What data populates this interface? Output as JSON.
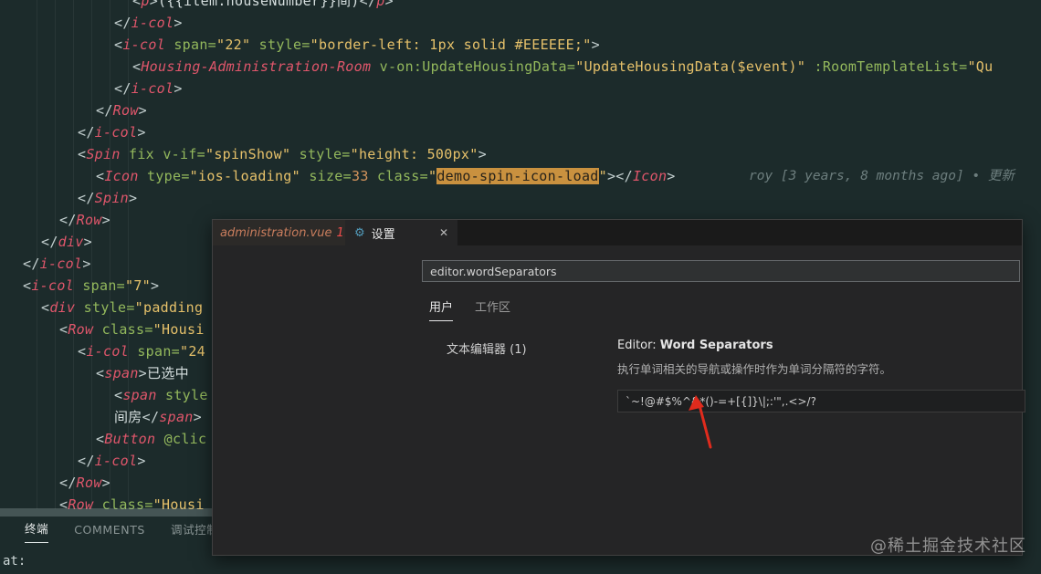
{
  "editor": {
    "lines": [
      {
        "indent": 6,
        "s": [
          [
            "br",
            "<"
          ],
          [
            "tag",
            "p"
          ],
          [
            "br",
            ">"
          ],
          [
            "txt",
            "({{item.houseNumber}}间)"
          ],
          [
            "br",
            "</"
          ],
          [
            "tag",
            "p"
          ],
          [
            "br",
            ">"
          ]
        ]
      },
      {
        "indent": 5,
        "s": [
          [
            "br",
            "</"
          ],
          [
            "tag",
            "i-col"
          ],
          [
            "br",
            ">"
          ]
        ]
      },
      {
        "indent": 5,
        "s": [
          [
            "br",
            "<"
          ],
          [
            "tag",
            "i-col"
          ],
          [
            "attr",
            " span="
          ],
          [
            "str",
            "\"22\""
          ],
          [
            "attr",
            " style="
          ],
          [
            "str",
            "\"border-left: 1px solid #EEEEEE;\""
          ],
          [
            "br",
            ">"
          ]
        ]
      },
      {
        "indent": 6,
        "s": [
          [
            "br",
            "<"
          ],
          [
            "tag",
            "Housing-Administration-Room"
          ],
          [
            "attr",
            " v-on:UpdateHousingData="
          ],
          [
            "str",
            "\"UpdateHousingData($event)\""
          ],
          [
            "attr",
            " :RoomTemplateList="
          ],
          [
            "str",
            "\"Qu"
          ]
        ]
      },
      {
        "indent": 5,
        "s": [
          [
            "br",
            "</"
          ],
          [
            "tag",
            "i-col"
          ],
          [
            "br",
            ">"
          ]
        ]
      },
      {
        "indent": 4,
        "s": [
          [
            "br",
            "</"
          ],
          [
            "tag",
            "Row"
          ],
          [
            "br",
            ">"
          ]
        ]
      },
      {
        "indent": 3,
        "s": [
          [
            "br",
            "</"
          ],
          [
            "tag",
            "i-col"
          ],
          [
            "br",
            ">"
          ]
        ]
      },
      {
        "indent": 3,
        "s": [
          [
            "br",
            "<"
          ],
          [
            "tag",
            "Spin"
          ],
          [
            "attr",
            " fix v-if="
          ],
          [
            "str",
            "\"spinShow\""
          ],
          [
            "attr",
            " style="
          ],
          [
            "str",
            "\"height: 500px\""
          ],
          [
            "br",
            ">"
          ]
        ]
      },
      {
        "indent": 4,
        "s": [
          [
            "br",
            "<"
          ],
          [
            "tag",
            "Icon"
          ],
          [
            "attr",
            " type="
          ],
          [
            "str",
            "\"ios-loading\""
          ],
          [
            "attr",
            " size="
          ],
          [
            "num",
            "33"
          ],
          [
            "attr",
            " class="
          ],
          [
            "str",
            "\""
          ],
          [
            "hl",
            "demo-spin-icon-load"
          ],
          [
            "str",
            "\""
          ],
          [
            "br",
            "></"
          ],
          [
            "tag",
            "Icon"
          ],
          [
            "br",
            ">"
          ]
        ]
      },
      {
        "indent": 3,
        "s": [
          [
            "br",
            "</"
          ],
          [
            "tag",
            "Spin"
          ],
          [
            "br",
            ">"
          ]
        ]
      },
      {
        "indent": 2,
        "s": [
          [
            "br",
            "</"
          ],
          [
            "tag",
            "Row"
          ],
          [
            "br",
            ">"
          ]
        ]
      },
      {
        "indent": 1,
        "s": [
          [
            "br",
            "</"
          ],
          [
            "tag",
            "div"
          ],
          [
            "br",
            ">"
          ]
        ]
      },
      {
        "indent": 0,
        "s": [
          [
            "br",
            "</"
          ],
          [
            "tag",
            "i-col"
          ],
          [
            "br",
            ">"
          ]
        ]
      },
      {
        "indent": 0,
        "s": [
          [
            "br",
            "<"
          ],
          [
            "tag",
            "i-col"
          ],
          [
            "attr",
            " span="
          ],
          [
            "str",
            "\"7\""
          ],
          [
            "br",
            ">"
          ]
        ]
      },
      {
        "indent": 1,
        "s": [
          [
            "br",
            "<"
          ],
          [
            "tag",
            "div"
          ],
          [
            "attr",
            " style="
          ],
          [
            "str",
            "\"padding"
          ]
        ]
      },
      {
        "indent": 2,
        "s": [
          [
            "br",
            "<"
          ],
          [
            "tag",
            "Row"
          ],
          [
            "attr",
            " class="
          ],
          [
            "str",
            "\"Housi"
          ]
        ]
      },
      {
        "indent": 3,
        "s": [
          [
            "br",
            "<"
          ],
          [
            "tag",
            "i-col"
          ],
          [
            "attr",
            " span="
          ],
          [
            "str",
            "\"24"
          ]
        ]
      },
      {
        "indent": 4,
        "s": [
          [
            "br",
            "<"
          ],
          [
            "tag",
            "span"
          ],
          [
            "br",
            ">"
          ],
          [
            "txt",
            "已选中"
          ]
        ]
      },
      {
        "indent": 5,
        "s": [
          [
            "br",
            "<"
          ],
          [
            "tag",
            "span"
          ],
          [
            "attr",
            " style"
          ]
        ]
      },
      {
        "indent": 5,
        "s": [
          [
            "txt",
            "间房"
          ],
          [
            "br",
            "</"
          ],
          [
            "tag",
            "span"
          ],
          [
            "br",
            ">"
          ]
        ]
      },
      {
        "indent": 4,
        "s": [
          [
            "br",
            "<"
          ],
          [
            "tag",
            "Button"
          ],
          [
            "attr",
            " @clic"
          ]
        ]
      },
      {
        "indent": 3,
        "s": [
          [
            "br",
            "</"
          ],
          [
            "tag",
            "i-col"
          ],
          [
            "br",
            ">"
          ]
        ]
      },
      {
        "indent": 2,
        "s": [
          [
            "br",
            "</"
          ],
          [
            "tag",
            "Row"
          ],
          [
            "br",
            ">"
          ]
        ]
      },
      {
        "indent": 2,
        "s": [
          [
            "br",
            "<"
          ],
          [
            "tag",
            "Row"
          ],
          [
            "attr",
            " class="
          ],
          [
            "str",
            "\"Housi"
          ]
        ]
      }
    ],
    "blame": {
      "line": 9,
      "text": "roy [3 years, 8 months ago] • 更新"
    }
  },
  "panel": {
    "tabs": [
      {
        "label": "终端",
        "active": true
      },
      {
        "label": "COMMENTS",
        "active": false
      },
      {
        "label": "调试控制台",
        "active": false
      }
    ],
    "prompt": "at:"
  },
  "settings_panel": {
    "file_tab": {
      "label": "administration.vue",
      "badge": "1"
    },
    "settings_tab": {
      "label": "设置"
    },
    "icons": {
      "settings_file": "⚙",
      "close": "✕"
    },
    "search_value": "editor.wordSeparators",
    "scopes": [
      {
        "label": "用户",
        "active": true
      },
      {
        "label": "工作区",
        "active": false
      }
    ],
    "toc_item": "文本编辑器 (1)",
    "setting": {
      "category": "Editor: ",
      "name": "Word Separators",
      "description": "执行单词相关的导航或操作时作为单词分隔符的字符。",
      "value": "`~!@#$%^&*()-=+[{]}\\|;:'\",.<>/?"
    }
  },
  "watermark": "@稀土掘金技术社区",
  "colors": {
    "editor_background": "#1c2b2b",
    "dialog_background": "#252526",
    "highlight_bg": "#c9913f",
    "tag": "#e0566b",
    "attribute": "#93b85c",
    "string": "#e6c16a",
    "accent_blue": "#519aba",
    "badge_red": "#f14c4c",
    "arrow_red": "#e02b1d"
  }
}
